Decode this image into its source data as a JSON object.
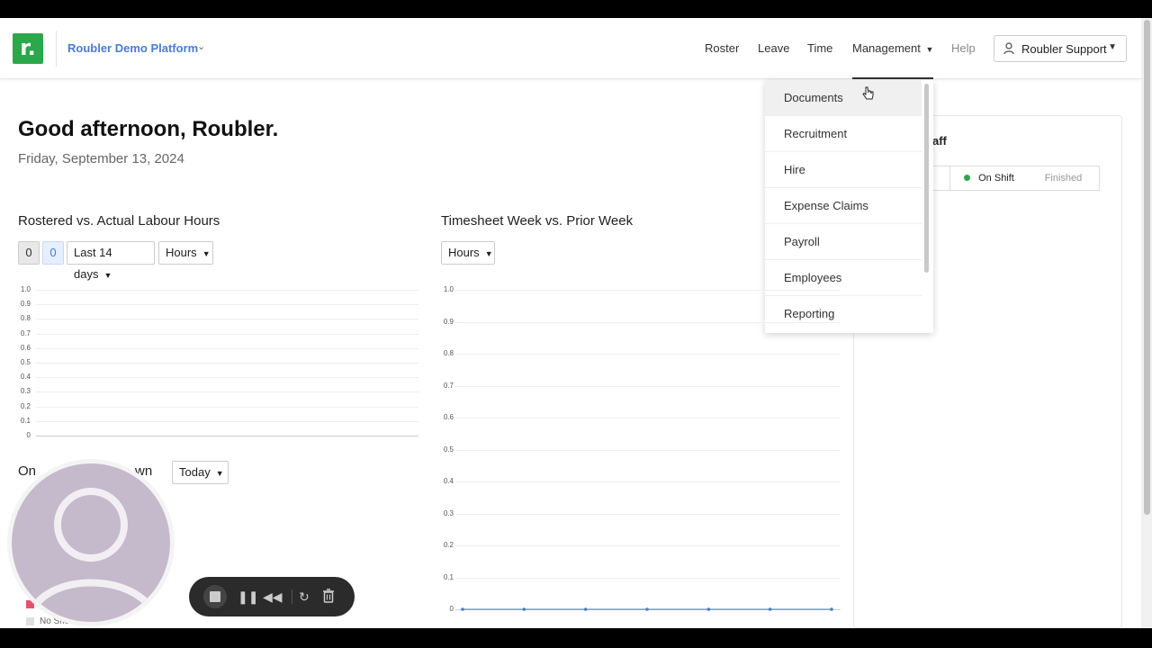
{
  "header": {
    "logo_letter": "r.",
    "org_name": "Roubler Demo Platform",
    "org_caret": "⌄",
    "nav": {
      "roster": "Roster",
      "leave": "Leave",
      "time": "Time",
      "management": "Management",
      "help": "Help"
    },
    "user_label": "Roubler Support"
  },
  "greeting": {
    "title": "Good afternoon, Roubler.",
    "date": "Friday, September 13, 2024"
  },
  "labour_chart": {
    "title": "Rostered vs. Actual Labour Hours",
    "toggle_a": "0",
    "toggle_b": "0",
    "range_label": "Last 14 days",
    "unit_label": "Hours"
  },
  "timesheet_chart": {
    "title": "Timesheet Week vs. Prior Week",
    "unit_label": "Hours"
  },
  "breakdown": {
    "title_start": "On",
    "title_end": "wn",
    "period_label": "Today",
    "legend_no_show": "No Show"
  },
  "staff_panel": {
    "title_fragment": "aff",
    "on_shift": "On Shift",
    "finished": "Finished"
  },
  "management_menu": {
    "items": [
      "Documents",
      "Recruitment",
      "Hire",
      "Expense Claims",
      "Payroll",
      "Employees",
      "Reporting"
    ]
  },
  "chart_data": [
    {
      "type": "line",
      "title": "Rostered vs. Actual Labour Hours",
      "yticks": [
        "1.0",
        "0.9",
        "0.8",
        "0.7",
        "0.6",
        "0.5",
        "0.4",
        "0.3",
        "0.2",
        "0.1",
        "0"
      ],
      "ylim": [
        0,
        1
      ],
      "series": [],
      "grid": true
    },
    {
      "type": "line",
      "title": "Timesheet Week vs. Prior Week",
      "yticks": [
        "1.0",
        "0.9",
        "0.8",
        "0.7",
        "0.6",
        "0.5",
        "0.4",
        "0.3",
        "0.2",
        "0.1",
        "0"
      ],
      "ylim": [
        0,
        1
      ],
      "series": [
        {
          "values": [
            0,
            0,
            0,
            0,
            0,
            0,
            0
          ]
        }
      ],
      "grid": true
    }
  ],
  "colors": {
    "brand": "#2aa84a",
    "link": "#4a7bd0",
    "on_shift_dot": "#2aa84a",
    "series_line": "#4a7bd0",
    "no_show_swatch": "#e0e0e0",
    "legend_red": "#e5536b"
  },
  "icons": {
    "user": "user-icon",
    "recorder": [
      "stop-icon",
      "pause-icon",
      "rewind-icon",
      "restart-icon",
      "trash-icon"
    ]
  }
}
